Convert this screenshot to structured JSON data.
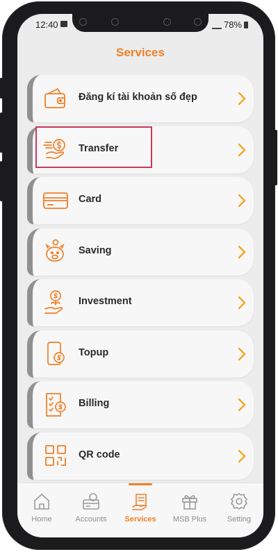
{
  "status_bar": {
    "time": "12:40",
    "battery": "78%"
  },
  "header": {
    "title": "Services"
  },
  "colors": {
    "accent": "#f07f26",
    "highlight": "#c9385c"
  },
  "services": [
    {
      "label": "Đăng kí tài khoản số đẹp",
      "icon": "wallet-icon"
    },
    {
      "label": "Transfer",
      "icon": "money-transfer-icon"
    },
    {
      "label": "Card",
      "icon": "card-icon"
    },
    {
      "label": "Saving",
      "icon": "piggy-bank-icon"
    },
    {
      "label": "Investment",
      "icon": "investment-icon"
    },
    {
      "label": "Topup",
      "icon": "phone-topup-icon"
    },
    {
      "label": "Billing",
      "icon": "billing-icon"
    },
    {
      "label": "QR code",
      "icon": "qr-code-icon"
    }
  ],
  "tabbar": {
    "items": [
      {
        "label": "Home",
        "icon": "home-icon",
        "active": false
      },
      {
        "label": "Accounts",
        "icon": "accounts-icon",
        "active": false
      },
      {
        "label": "Services",
        "icon": "services-icon",
        "active": true
      },
      {
        "label": "MSB Plus",
        "icon": "gift-icon",
        "active": false
      },
      {
        "label": "Setting",
        "icon": "gear-icon",
        "active": false
      }
    ]
  }
}
